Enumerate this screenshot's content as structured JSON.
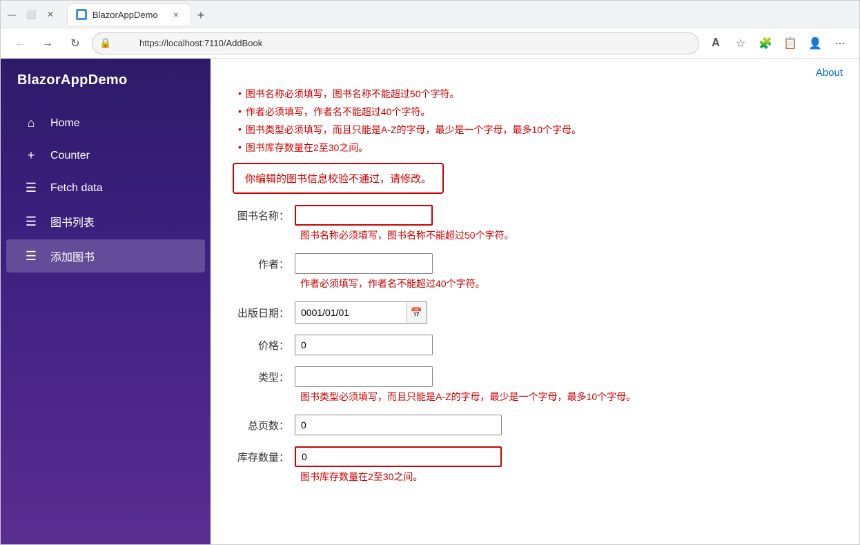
{
  "browser": {
    "tab_title": "BlazorAppDemo",
    "url": "https://localhost:7110/AddBook",
    "new_tab_label": "+",
    "close_tab_label": "×",
    "back_label": "←",
    "forward_label": "→",
    "refresh_label": "↻"
  },
  "sidebar": {
    "app_title": "BlazorAppDemo",
    "items": [
      {
        "id": "home",
        "label": "Home",
        "icon": "⌂"
      },
      {
        "id": "counter",
        "label": "Counter",
        "icon": "+"
      },
      {
        "id": "fetch-data",
        "label": "Fetch data",
        "icon": "☰"
      },
      {
        "id": "book-list",
        "label": "图书列表",
        "icon": "☰"
      },
      {
        "id": "add-book",
        "label": "添加图书",
        "icon": "☰",
        "active": true
      }
    ]
  },
  "header": {
    "about_label": "About"
  },
  "validation_messages": [
    "图书名称必须填写，图书名称不能超过50个字符。",
    "作者必须填写，作者名不能超过40个字符。",
    "图书类型必须填写，而且只能是A-Z的字母，最少是一个字母，最多10个字母。",
    "图书库存数量在2至30之间。"
  ],
  "form_alert": "你编辑的图书信息校验不通过，请修改。",
  "form": {
    "book_name_label": "图书名称：",
    "book_name_value": "",
    "book_name_error": "图书名称必须填写，图书名称不能超过50个字符。",
    "author_label": "作者：",
    "author_value": "",
    "author_error": "作者必须填写，作者名不能超过40个字符。",
    "pub_date_label": "出版日期：",
    "pub_date_value": "0001/01/01",
    "price_label": "价格：",
    "price_value": "0",
    "type_label": "类型：",
    "type_value": "",
    "type_error": "图书类型必须填写，而且只能是A-Z的字母，最少是一个字母，最多10个字母。",
    "pages_label": "总页数：",
    "pages_value": "0",
    "stock_label": "库存数量：",
    "stock_value": "0",
    "stock_error": "图书库存数量在2至30之间。"
  }
}
